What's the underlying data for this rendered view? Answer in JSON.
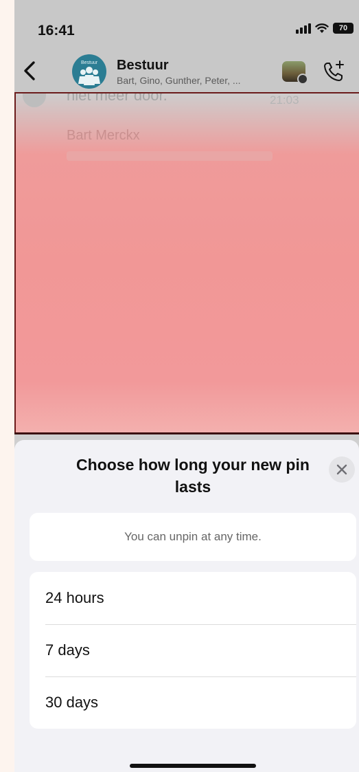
{
  "status_bar": {
    "time": "16:41",
    "battery": "70"
  },
  "header": {
    "avatar_text": "Bestuur",
    "title": "Bestuur",
    "subtitle": "Bart, Gino, Gunther, Peter, ..."
  },
  "chat_preview": {
    "message": "niet meer door.",
    "time": "21:03",
    "sender": "Bart Merckx"
  },
  "sheet": {
    "title": "Choose how long your new pin lasts",
    "info": "You can unpin at any time.",
    "options": [
      {
        "label": "24 hours"
      },
      {
        "label": "7 days"
      },
      {
        "label": "30 days"
      }
    ]
  },
  "colors": {
    "sheet_background": "#f2f2f6",
    "chat_overlay": "#f19796",
    "avatar": "#2b7d93"
  },
  "icons": {
    "back": "chevron-left-icon",
    "call": "phone-plus-icon",
    "close": "close-icon",
    "wifi": "wifi-icon",
    "signal": "signal-icon",
    "battery": "battery-icon"
  }
}
